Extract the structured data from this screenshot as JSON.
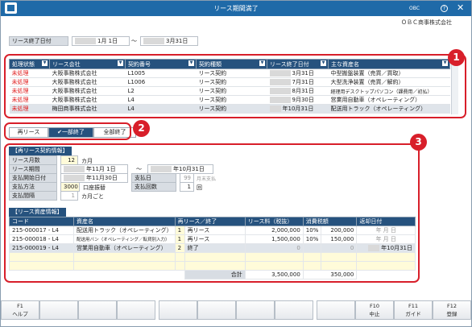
{
  "window": {
    "title": "リース期間満了",
    "logo": "OBC",
    "company": "ＯＢＣ商事株式会社"
  },
  "period": {
    "label": "リース終了日付",
    "from": "1月  1日",
    "sep": "～",
    "to": "3月31日"
  },
  "grid1": {
    "headers": [
      "処理状態",
      "リース会社",
      "契約番号",
      "契約種類",
      "リース終了日付",
      "主な資産名"
    ],
    "rows": [
      {
        "status": "未処理",
        "company": "大阪事務株式会社",
        "contract": "L1005",
        "type": "リース契約",
        "end": "3月31日",
        "asset": "中型搬盤装置（売買／買取）"
      },
      {
        "status": "未処理",
        "company": "大阪事務株式会社",
        "contract": "L1006",
        "type": "リース契約",
        "end": "7月31日",
        "asset": "大型洗浄装置（売買／解約）"
      },
      {
        "status": "未処理",
        "company": "大阪事務株式会社",
        "contract": "L2",
        "type": "リース契約",
        "end": "8月31日",
        "asset": "経理用デスクトップパソコン（課費用／初払）"
      },
      {
        "status": "未処理",
        "company": "大阪事務株式会社",
        "contract": "L4",
        "type": "リース契約",
        "end": "9月30日",
        "asset": "営業用自動車（オペレーティング）"
      },
      {
        "status": "未処理",
        "company": "梅田商事株式会社",
        "contract": "L4",
        "type": "リース契約",
        "end": "年10月31日",
        "asset": "配送用トラック（オペレーティング）"
      }
    ]
  },
  "tabs": [
    "再リース",
    "一部終了",
    "全部終了"
  ],
  "contract": {
    "section": "【再リース契約情報】",
    "months_label": "リース月数",
    "months_value": "12",
    "months_unit": "カ月",
    "period_label": "リース期間",
    "period_from": "年11月  1日",
    "period_sep": "～",
    "period_to": "年10月31日",
    "pay_start_label": "支払開始日付",
    "pay_start_value": "年11月30日",
    "pay_day_label": "支払日",
    "pay_day_value": "99",
    "pay_day_unit": "月末支払",
    "pay_method_label": "支払方法",
    "pay_method_value": "3000",
    "pay_method_name": "口座振替",
    "pay_count_label": "支払回数",
    "pay_count_value": "1",
    "pay_count_unit": "回",
    "interval_label": "支払間隔",
    "interval_value": "1",
    "interval_unit": "カ月ごと"
  },
  "assets": {
    "section": "【リース資産情報】",
    "headers": [
      "コード",
      "資産名",
      "再リース／終了",
      "リース料（税抜）",
      "消費税額",
      "返却日付"
    ],
    "rows": [
      {
        "code": "215-000017 - L4",
        "name": "配送用トラック（オペレーティング）",
        "n": "1",
        "kind": "再リース",
        "fee": "2,000,000",
        "rate": "10%",
        "tax": "200,000",
        "ret": "年  月  日"
      },
      {
        "code": "215-000018 - L4",
        "name": "配送用バン（オペレーティング／転貸別入力）",
        "n": "1",
        "kind": "再リース",
        "fee": "1,500,000",
        "rate": "10%",
        "tax": "150,000",
        "ret": "年  月  日"
      },
      {
        "code": "215-000019 - L4",
        "name": "営業用自動車（オペレーティング）",
        "n": "2",
        "kind": "終了",
        "fee": "0",
        "rate": "",
        "tax": "0",
        "ret": "年10月31日"
      }
    ],
    "total_label": "合計",
    "total_fee": "3,500,000",
    "total_tax": "350,000"
  },
  "badges": [
    "1",
    "2",
    "3"
  ],
  "fkeys": [
    {
      "key": "F1",
      "label": "ヘルプ"
    },
    {
      "key": "",
      "label": ""
    },
    {
      "key": "",
      "label": ""
    },
    {
      "key": "",
      "label": ""
    },
    {
      "key": "",
      "label": ""
    },
    {
      "key": "",
      "label": ""
    },
    {
      "key": "",
      "label": ""
    },
    {
      "key": "",
      "label": ""
    },
    {
      "key": "",
      "label": ""
    },
    {
      "key": "F10",
      "label": "中止"
    },
    {
      "key": "F11",
      "label": "ガイド"
    },
    {
      "key": "F12",
      "label": "登録"
    }
  ]
}
